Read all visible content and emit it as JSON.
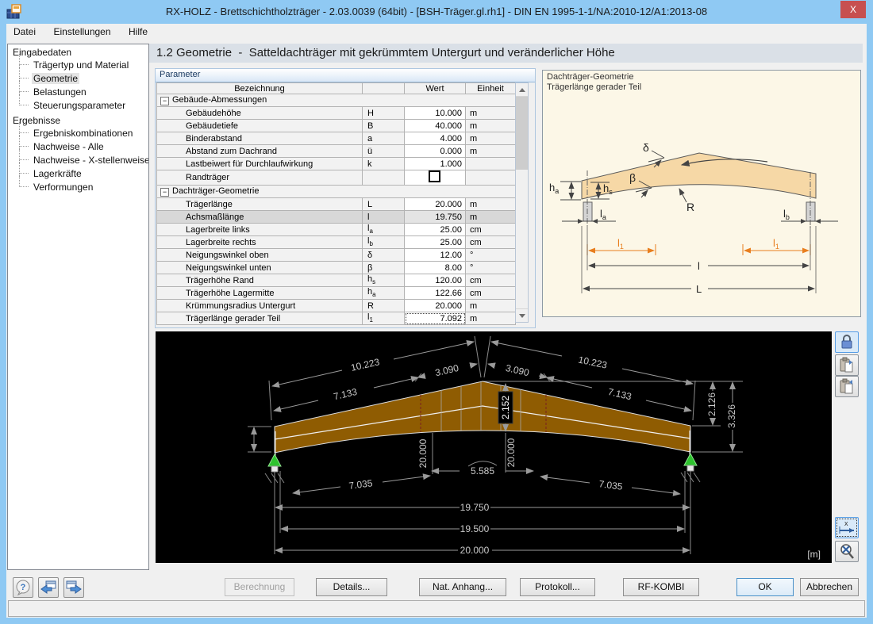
{
  "window": {
    "title": "RX-HOLZ - Brettschichtholzträger - 2.03.0039 (64bit) - [BSH-Träger.gl.rh1] - DIN EN 1995-1-1/NA:2010-12/A1:2013-08",
    "close_glyph": "X"
  },
  "menu": {
    "items": [
      "Datei",
      "Einstellungen",
      "Hilfe"
    ]
  },
  "sidebar": {
    "groups": [
      {
        "label": "Eingabedaten",
        "items": [
          {
            "label": "Trägertyp und Material",
            "selected": false
          },
          {
            "label": "Geometrie",
            "selected": true
          },
          {
            "label": "Belastungen",
            "selected": false
          },
          {
            "label": "Steuerungsparameter",
            "selected": false
          }
        ]
      },
      {
        "label": "Ergebnisse",
        "items": [
          {
            "label": "Ergebniskombinationen",
            "selected": false
          },
          {
            "label": "Nachweise - Alle",
            "selected": false
          },
          {
            "label": "Nachweise - X-stellenweise",
            "selected": false
          },
          {
            "label": "Lagerkräfte",
            "selected": false
          },
          {
            "label": "Verformungen",
            "selected": false
          }
        ]
      }
    ]
  },
  "section_title": "1.2 Geometrie  -  Satteldachträger mit gekrümmtem Untergurt und veränderlicher Höhe",
  "parameter_panel": {
    "group_label": "Parameter",
    "collapse_glyph": "−",
    "columns": {
      "name": "Bezeichnung",
      "symbol": "",
      "value": "Wert",
      "unit": "Einheit"
    },
    "rows": [
      {
        "type": "section",
        "label": "Gebäude-Abmessungen"
      },
      {
        "type": "data",
        "label": "Gebäudehöhe",
        "sym": "H",
        "sub": "",
        "value": "10.000",
        "unit": "m"
      },
      {
        "type": "data",
        "label": "Gebäudetiefe",
        "sym": "B",
        "sub": "",
        "value": "40.000",
        "unit": "m"
      },
      {
        "type": "data",
        "label": "Binderabstand",
        "sym": "a",
        "sub": "",
        "value": "4.000",
        "unit": "m"
      },
      {
        "type": "data",
        "label": "Abstand zum Dachrand",
        "sym": "ü",
        "sub": "",
        "value": "0.000",
        "unit": "m"
      },
      {
        "type": "data",
        "label": "Lastbeiwert für Durchlaufwirkung",
        "sym": "k",
        "sub": "",
        "value": "1.000",
        "unit": ""
      },
      {
        "type": "checkbox",
        "label": "Randträger",
        "checked": false
      },
      {
        "type": "section",
        "label": "Dachträger-Geometrie"
      },
      {
        "type": "data",
        "label": "Trägerlänge",
        "sym": "L",
        "sub": "",
        "value": "20.000",
        "unit": "m"
      },
      {
        "type": "data",
        "label": "Achsmaßlänge",
        "sym": "l",
        "sub": "",
        "value": "19.750",
        "unit": "m",
        "selected": true
      },
      {
        "type": "data",
        "label": "Lagerbreite links",
        "sym": "l",
        "sub": "a",
        "value": "25.00",
        "unit": "cm"
      },
      {
        "type": "data",
        "label": "Lagerbreite rechts",
        "sym": "l",
        "sub": "b",
        "value": "25.00",
        "unit": "cm"
      },
      {
        "type": "data",
        "label": "Neigungswinkel oben",
        "sym": "δ",
        "sub": "",
        "value": "12.00",
        "unit": "°"
      },
      {
        "type": "data",
        "label": "Neigungswinkel unten",
        "sym": "β",
        "sub": "",
        "value": "8.00",
        "unit": "°"
      },
      {
        "type": "data",
        "label": "Trägerhöhe Rand",
        "sym": "h",
        "sub": "s",
        "value": "120.00",
        "unit": "cm"
      },
      {
        "type": "data",
        "label": "Trägerhöhe Lagermitte",
        "sym": "h",
        "sub": "a",
        "value": "122.66",
        "unit": "cm"
      },
      {
        "type": "data",
        "label": "Krümmungsradius Untergurt",
        "sym": "R",
        "sub": "",
        "value": "20.000",
        "unit": "m"
      },
      {
        "type": "data",
        "label": "Trägerlänge gerader Teil",
        "sym": "l",
        "sub": "1",
        "value": "7.092",
        "unit": "m",
        "focused": true
      }
    ]
  },
  "info_panel": {
    "title": "Dachträger-Geometrie",
    "subtitle": "Trägerlänge gerader Teil",
    "labels": {
      "delta": "δ",
      "beta": "β",
      "radius": "R",
      "h_a": {
        "base": "h",
        "sub": "a"
      },
      "h_s": {
        "base": "h",
        "sub": "s"
      },
      "l_a": {
        "base": "l",
        "sub": "a"
      },
      "l_b": {
        "base": "l",
        "sub": "b"
      },
      "l_1": {
        "base": "l",
        "sub": "1"
      },
      "axis_length": "l",
      "total_length": "L"
    }
  },
  "canvas": {
    "unit_label": "[m]",
    "dims": {
      "top_outer_left": "10.223",
      "top_outer_right": "10.223",
      "top_inner_left": "7.133",
      "top_inner_right": "7.133",
      "apex_left": "3.090",
      "apex_right": "3.090",
      "apex_height": "2.152",
      "radius_left": "20.000",
      "radius_right": "20.000",
      "right_upper": "2.126",
      "right_total": "3.326",
      "arc_length": "5.585",
      "bottom_left": "7.035",
      "bottom_right": "7.035",
      "span_axis": "19.750",
      "span_clear": "19.500",
      "span_total": "20.000"
    }
  },
  "bottom_bar": {
    "help_glyph": "?",
    "buttons": {
      "berechnung": "Berechnung",
      "details": "Details...",
      "nat_anhang": "Nat. Anhang...",
      "protokoll": "Protokoll...",
      "rf_kombi": "RF-KOMBI",
      "ok": "OK",
      "cancel": "Abbrechen"
    }
  }
}
